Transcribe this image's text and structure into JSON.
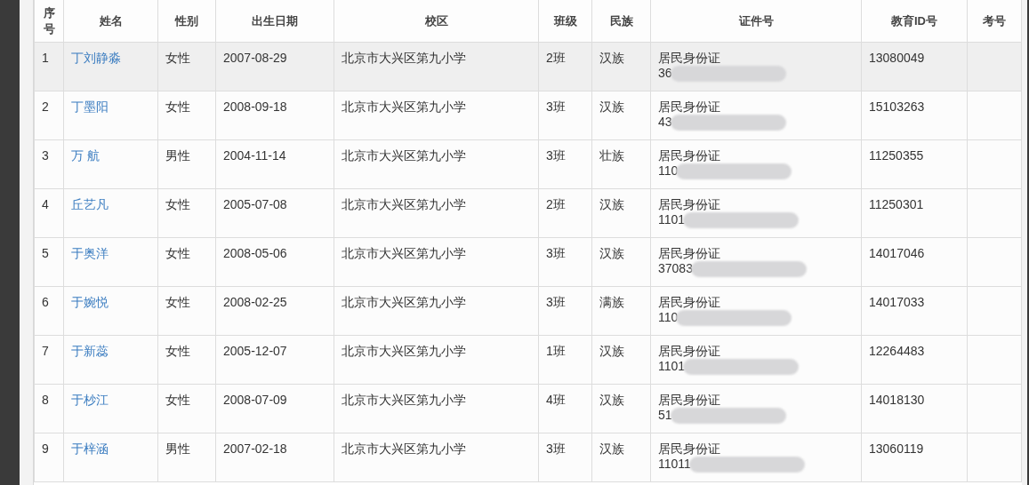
{
  "table": {
    "columns": [
      "序号",
      "姓名",
      "性别",
      "出生日期",
      "校区",
      "班级",
      "民族",
      "证件号",
      "教育ID号",
      "考号"
    ],
    "rows": [
      {
        "no": "1",
        "name": "丁刘静淼",
        "gender": "女性",
        "birth": "2007-08-29",
        "campus": "北京市大兴区第九小学",
        "class": "2班",
        "ethnicity": "汉族",
        "id_type": "居民身份证",
        "id_number": "36",
        "edu_id": "13080049",
        "highlighted": true
      },
      {
        "no": "2",
        "name": "丁墨阳",
        "gender": "女性",
        "birth": "2008-09-18",
        "campus": "北京市大兴区第九小学",
        "class": "3班",
        "ethnicity": "汉族",
        "id_type": "居民身份证",
        "id_number": "43",
        "edu_id": "15103263",
        "highlighted": false
      },
      {
        "no": "3",
        "name": "万 航",
        "gender": "男性",
        "birth": "2004-11-14",
        "campus": "北京市大兴区第九小学",
        "class": "3班",
        "ethnicity": "壮族",
        "id_type": "居民身份证",
        "id_number": "110",
        "edu_id": "11250355",
        "highlighted": false
      },
      {
        "no": "4",
        "name": "丘艺凡",
        "gender": "女性",
        "birth": "2005-07-08",
        "campus": "北京市大兴区第九小学",
        "class": "2班",
        "ethnicity": "汉族",
        "id_type": "居民身份证",
        "id_number": "1101",
        "edu_id": "11250301",
        "highlighted": false
      },
      {
        "no": "5",
        "name": "于奥洋",
        "gender": "女性",
        "birth": "2008-05-06",
        "campus": "北京市大兴区第九小学",
        "class": "3班",
        "ethnicity": "汉族",
        "id_type": "居民身份证",
        "id_number": "37083",
        "edu_id": "14017046",
        "highlighted": false
      },
      {
        "no": "6",
        "name": "于婉悦",
        "gender": "女性",
        "birth": "2008-02-25",
        "campus": "北京市大兴区第九小学",
        "class": "3班",
        "ethnicity": "满族",
        "id_type": "居民身份证",
        "id_number": "110",
        "edu_id": "14017033",
        "highlighted": false
      },
      {
        "no": "7",
        "name": "于新蕊",
        "gender": "女性",
        "birth": "2005-12-07",
        "campus": "北京市大兴区第九小学",
        "class": "1班",
        "ethnicity": "汉族",
        "id_type": "居民身份证",
        "id_number": "1101",
        "edu_id": "12264483",
        "highlighted": false
      },
      {
        "no": "8",
        "name": "于杪江",
        "gender": "女性",
        "birth": "2008-07-09",
        "campus": "北京市大兴区第九小学",
        "class": "4班",
        "ethnicity": "汉族",
        "id_type": "居民身份证",
        "id_number": "51",
        "edu_id": "14018130",
        "highlighted": false
      },
      {
        "no": "9",
        "name": "于梓涵",
        "gender": "男性",
        "birth": "2007-02-18",
        "campus": "北京市大兴区第九小学",
        "class": "3班",
        "ethnicity": "汉族",
        "id_type": "居民身份证",
        "id_number": "11011",
        "edu_id": "13060119",
        "highlighted": false
      }
    ]
  }
}
